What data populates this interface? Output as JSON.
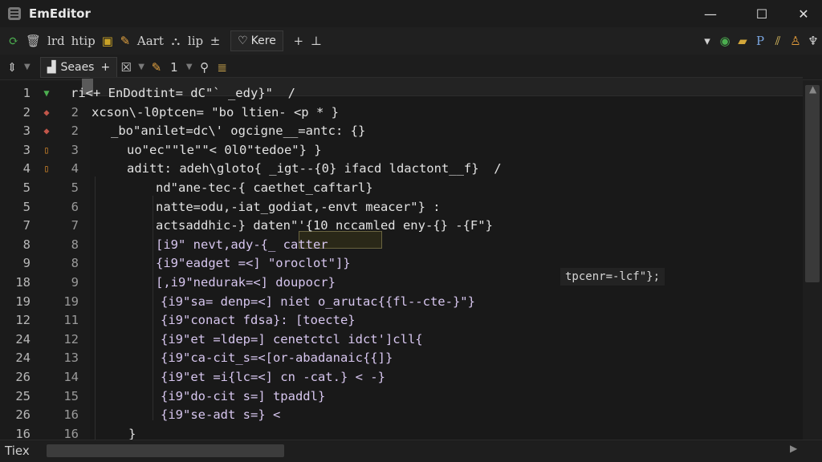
{
  "window": {
    "title": "EmEditor",
    "minimize": "—",
    "maximize": "☐",
    "close": "✕"
  },
  "toolbar1": {
    "items": [
      {
        "name": "refresh-icon",
        "glyph": "⟳",
        "color": "#4caf50"
      },
      {
        "name": "trash-icon",
        "glyph": "🗑",
        "color": "#bdbdbd"
      },
      {
        "name": "text-lrd",
        "text": "lrd"
      },
      {
        "name": "text-htip",
        "text": "htip"
      },
      {
        "name": "window-icon",
        "glyph": "▣",
        "color": "#c9a227"
      },
      {
        "name": "pencil-icon",
        "glyph": "✎",
        "color": "#e0a040"
      },
      {
        "name": "text-aart",
        "text": "Aart"
      },
      {
        "name": "tree-icon",
        "glyph": "⛬",
        "color": "#cfcfcf"
      },
      {
        "name": "text-lip",
        "text": "lip"
      },
      {
        "name": "plus-minus-icon",
        "glyph": "±",
        "color": "#cfcfcf"
      }
    ],
    "tab_label": "Kere",
    "right_items": [
      {
        "name": "plus-icon",
        "glyph": "+"
      },
      {
        "name": "bar-icon",
        "glyph": "⊥"
      },
      {
        "name": "dropdown-icon",
        "glyph": "▾"
      },
      {
        "name": "globe-icon",
        "glyph": "◉",
        "color": "#4caf50"
      },
      {
        "name": "folder-icon",
        "glyph": "▰",
        "color": "#d4a73a"
      },
      {
        "name": "p-icon",
        "glyph": "P",
        "color": "#7aa6e0"
      },
      {
        "name": "column-icon",
        "glyph": "⫽",
        "color": "#e0c060"
      },
      {
        "name": "user-icon",
        "glyph": "♙",
        "color": "#e09a3a"
      },
      {
        "name": "script-icon",
        "glyph": "♆",
        "color": "#d0d0d0"
      }
    ]
  },
  "toolbar2": {
    "search_label": "Seaes",
    "plus": "+",
    "close": "☒",
    "num": "1"
  },
  "editor": {
    "lines": [
      {
        "ln": "1",
        "ln2": "",
        "mark": "▼",
        "code": "ri&lt;+ EnDodtint= dC\"` _edy}\"  /"
      },
      {
        "ln": "2",
        "ln2": "2",
        "mark": "◆",
        "code": "xcson\\-l0ptcen= \"bo ltien- <p * }"
      },
      {
        "ln": "3",
        "ln2": "2",
        "mark": "◆",
        "code": "_bo\"anilet=dc\\' ogcigne__=antc: {}"
      },
      {
        "ln": "3",
        "ln2": "3",
        "mark": "▯",
        "code": "uo\"ec\"\"le\"\"&lt; 0l0\"tedoe\"} }"
      },
      {
        "ln": "4",
        "ln2": "4",
        "mark": "▯",
        "code": "aditt: adeh\\gloto{ _igt--{0} ifacd ldactont__f}  /"
      },
      {
        "ln": "5",
        "ln2": "5",
        "mark": "",
        "code": "nd\"ane-tec-{ caethet_caftarl}"
      },
      {
        "ln": "5",
        "ln2": "6",
        "mark": "",
        "code": "natte=odu,-iat_godiat,-envt meacer\"} :"
      },
      {
        "ln": "7",
        "ln2": "7",
        "mark": "",
        "code": "actsaddhic-} daten\"'{10 nccamled eny-{} -{F\"}"
      },
      {
        "ln": "8",
        "ln2": "8",
        "mark": "",
        "code": "[i9\" nevt,ady-{_ catter"
      },
      {
        "ln": "9",
        "ln2": "8",
        "mark": "",
        "code": "{i9\"eadget =&lt;] \"oroclot\"]}"
      },
      {
        "ln": "18",
        "ln2": "9",
        "mark": "",
        "code": "[,i9\"nedurak=&lt;] doupocr}"
      },
      {
        "ln": "19",
        "ln2": "19",
        "mark": "",
        "code": "{i9\"sa= denp=&lt;] niet o_arutac{{fl--cte-}\"}"
      },
      {
        "ln": "12",
        "ln2": "11",
        "mark": "",
        "code": "{i9\"conact fdsa}: [toecte}"
      },
      {
        "ln": "24",
        "ln2": "12",
        "mark": "",
        "code": "{i9\"et =ldep=] cenetctcl idct']cll{"
      },
      {
        "ln": "24",
        "ln2": "13",
        "mark": "",
        "code": "{i9\"ca-cit_s=&lt;[or-abadanaic{{]}"
      },
      {
        "ln": "26",
        "ln2": "14",
        "mark": "",
        "code": "{i9\"et =i{lc=&lt;] cn -cat.} &lt; -}"
      },
      {
        "ln": "25",
        "ln2": "15",
        "mark": "",
        "code": "{i9\"do-cit s=] tpaddl}"
      },
      {
        "ln": "26",
        "ln2": "16",
        "mark": "",
        "code": "{i9\"se-adt s=} &lt;"
      },
      {
        "ln": "16",
        "ln2": "16",
        "mark": "",
        "code": "}"
      }
    ],
    "tooltip": "tpcenr=-lcf\"};"
  },
  "status": {
    "text": "Tiex"
  }
}
